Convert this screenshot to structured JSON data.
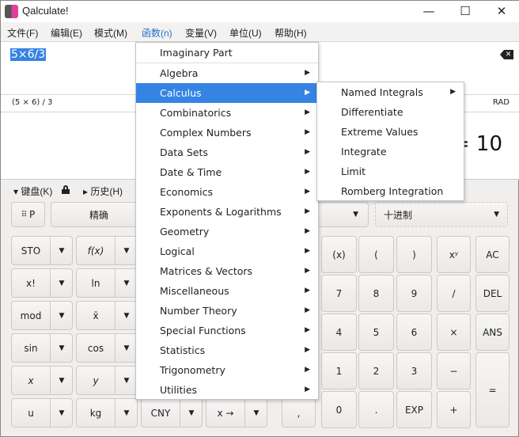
{
  "window": {
    "title": "Qalculate!",
    "minimize": "—",
    "maximize": "☐",
    "close": "✕"
  },
  "menubar": [
    "文件(F)",
    "编辑(E)",
    "模式(M)",
    "函数(n)",
    "变量(V)",
    "单位(U)",
    "帮助(H)"
  ],
  "expression": "5×6/3",
  "parsed": "(5 × 6) / 3",
  "angle_unit": "RAD",
  "result": "= 10",
  "toggles": {
    "keypad": "▾ 键盘(K)",
    "history": "▸ 历史(H)"
  },
  "toolbar": {
    "p": "P",
    "precision": "精确",
    "base": "十进制"
  },
  "left_keys": [
    [
      "STO",
      "f(x)",
      "",
      ""
    ],
    [
      "x!",
      "ln",
      "",
      ""
    ],
    [
      "mod",
      "x̄",
      "",
      ""
    ],
    [
      "sin",
      "cos",
      "",
      ""
    ],
    [
      "x",
      "y",
      "",
      ""
    ],
    [
      "u",
      "kg",
      "CNY",
      "x →"
    ]
  ],
  "comma_key": ",",
  "right_keys": [
    [
      "(x)",
      "(",
      ")",
      "xʸ",
      "AC"
    ],
    [
      "7",
      "8",
      "9",
      "∕",
      "DEL"
    ],
    [
      "4",
      "5",
      "6",
      "×",
      "ANS"
    ],
    [
      "1",
      "2",
      "3",
      "−",
      "="
    ],
    [
      "0",
      ".",
      "EXP",
      "+",
      ""
    ]
  ],
  "functions_menu": {
    "items": [
      "Imaginary Part",
      "Algebra",
      "Calculus",
      "Combinatorics",
      "Complex Numbers",
      "Data Sets",
      "Date & Time",
      "Economics",
      "Exponents & Logarithms",
      "Geometry",
      "Logical",
      "Matrices & Vectors",
      "Miscellaneous",
      "Number Theory",
      "Special Functions",
      "Statistics",
      "Trigonometry",
      "Utilities"
    ],
    "highlighted": "Calculus"
  },
  "calculus_submenu": {
    "items": [
      "Named Integrals",
      "Differentiate",
      "Extreme Values",
      "Integrate",
      "Limit",
      "Romberg Integration"
    ]
  },
  "colors": {
    "accent": "#3584e4"
  }
}
